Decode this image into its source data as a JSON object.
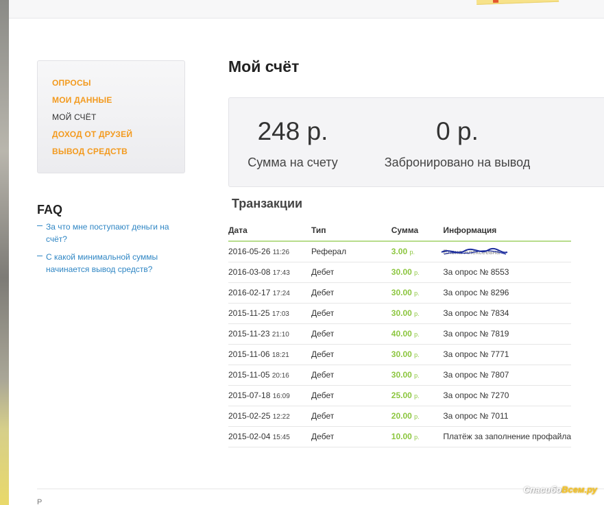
{
  "sidebar": {
    "items": [
      {
        "label": "ОПРОСЫ"
      },
      {
        "label": "МОИ ДАННЫЕ"
      },
      {
        "label": "МОЙ СЧЁТ"
      },
      {
        "label": "ДОХОД ОТ ДРУЗЕЙ"
      },
      {
        "label": "ВЫВОД СРЕДСТВ"
      }
    ],
    "active_index": 2
  },
  "faq": {
    "title": "FAQ",
    "items": [
      {
        "label": "За что мне поступают деньги на счёт?"
      },
      {
        "label": "С какой минимальной суммы начинается вывод средств?"
      }
    ]
  },
  "main": {
    "title": "Мой счёт",
    "balance": {
      "amount": "248 р.",
      "caption": "Сумма на счету"
    },
    "reserved": {
      "amount": "0 р.",
      "caption": "Забронировано на вывод"
    },
    "transactions_title": "Транзакции",
    "table": {
      "headers": {
        "date": "Дата",
        "type": "Тип",
        "sum": "Сумма",
        "info": "Информация"
      },
      "rows": [
        {
          "date": "2016-05-26",
          "time": "11:26",
          "type": "Реферал",
          "sum": "3.00",
          "currency": "р.",
          "info": "Елена Алексеевна"
        },
        {
          "date": "2016-03-08",
          "time": "17:43",
          "type": "Дебет",
          "sum": "30.00",
          "currency": "р.",
          "info": "За опрос № 8553"
        },
        {
          "date": "2016-02-17",
          "time": "17:24",
          "type": "Дебет",
          "sum": "30.00",
          "currency": "р.",
          "info": "За опрос № 8296"
        },
        {
          "date": "2015-11-25",
          "time": "17:03",
          "type": "Дебет",
          "sum": "30.00",
          "currency": "р.",
          "info": "За опрос № 7834"
        },
        {
          "date": "2015-11-23",
          "time": "21:10",
          "type": "Дебет",
          "sum": "40.00",
          "currency": "р.",
          "info": "За опрос № 7819"
        },
        {
          "date": "2015-11-06",
          "time": "18:21",
          "type": "Дебет",
          "sum": "30.00",
          "currency": "р.",
          "info": "За опрос № 7771"
        },
        {
          "date": "2015-11-05",
          "time": "20:16",
          "type": "Дебет",
          "sum": "30.00",
          "currency": "р.",
          "info": "За опрос № 7807"
        },
        {
          "date": "2015-07-18",
          "time": "16:09",
          "type": "Дебет",
          "sum": "25.00",
          "currency": "р.",
          "info": "За опрос № 7270"
        },
        {
          "date": "2015-02-25",
          "time": "12:22",
          "type": "Дебет",
          "sum": "20.00",
          "currency": "р.",
          "info": "За опрос № 7011"
        },
        {
          "date": "2015-02-04",
          "time": "15:45",
          "type": "Дебет",
          "sum": "10.00",
          "currency": "р.",
          "info": "Платёж за заполнение профайла"
        }
      ]
    }
  },
  "footer": {
    "partial_text": "Р"
  },
  "watermark": {
    "part1": "Спасибо",
    "part2": "Всем.ру"
  },
  "colors": {
    "accent": "#f39a1e",
    "link": "#2f86c4",
    "money": "#8cc63f",
    "table_rule": "#b7dc8b"
  }
}
